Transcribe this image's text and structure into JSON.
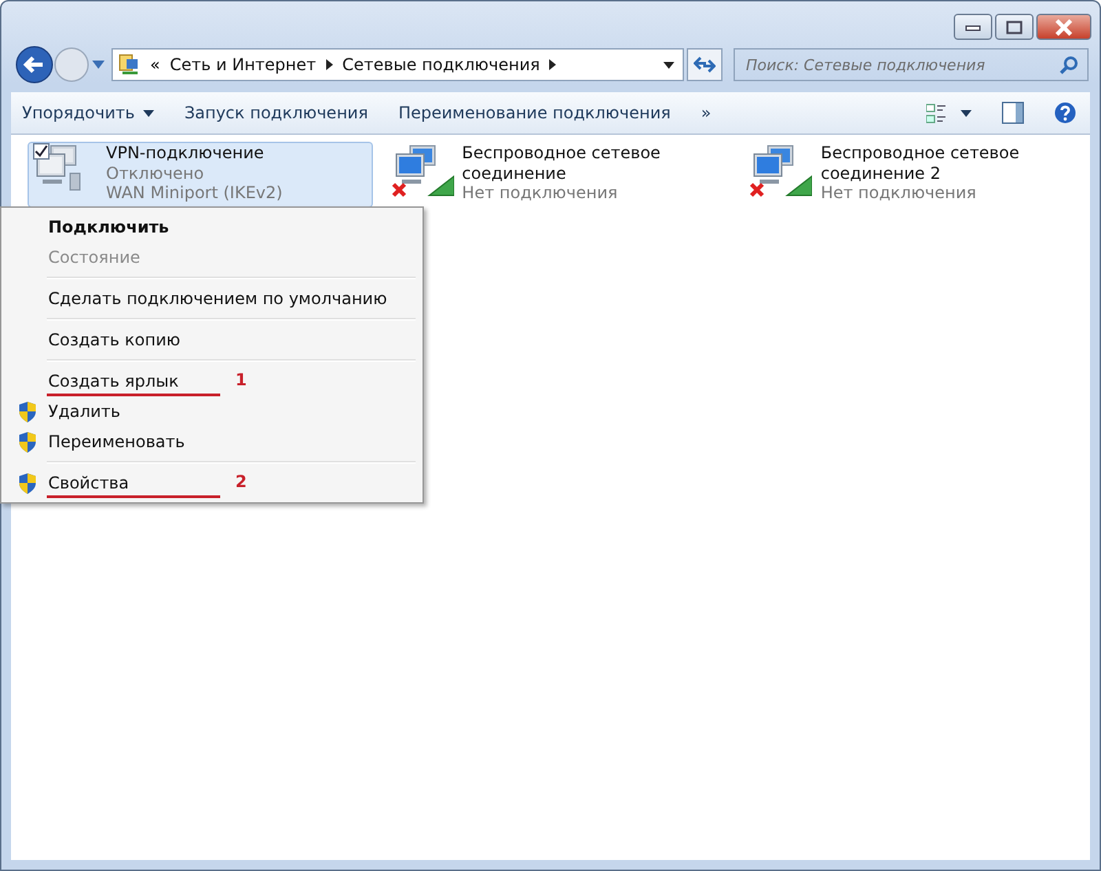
{
  "address_bar": {
    "overflow": "«",
    "crumbs": [
      "Сеть и Интернет",
      "Сетевые подключения"
    ]
  },
  "search": {
    "placeholder": "Поиск: Сетевые подключения"
  },
  "toolbar": {
    "items": [
      {
        "label": "Упорядочить",
        "dropdown": true
      },
      {
        "label": "Запуск подключения",
        "dropdown": false
      },
      {
        "label": "Переименование подключения",
        "dropdown": false
      }
    ],
    "more": "»"
  },
  "connections": [
    {
      "kind": "vpn",
      "name": "VPN-подключение",
      "status": "Отключено",
      "device": "WAN Miniport (IKEv2)",
      "selected": true,
      "checked": true
    },
    {
      "kind": "wireless",
      "name": "Беспроводное сетевое соединение",
      "status": "Нет подключения",
      "selected": false,
      "checked": false
    },
    {
      "kind": "wireless",
      "name": "Беспроводное сетевое соединение 2",
      "status": "Нет подключения",
      "selected": false,
      "checked": false
    }
  ],
  "context_menu": {
    "sections": [
      [
        {
          "label": "Подключить",
          "default": true,
          "disabled": false,
          "shield": false
        },
        {
          "label": "Состояние",
          "default": false,
          "disabled": true,
          "shield": false
        }
      ],
      [
        {
          "label": "Сделать подключением по умолчанию",
          "default": false,
          "disabled": false,
          "shield": false
        }
      ],
      [
        {
          "label": "Создать копию",
          "default": false,
          "disabled": false,
          "shield": false
        }
      ],
      [
        {
          "label": "Создать ярлык",
          "default": false,
          "disabled": false,
          "shield": false,
          "annotation": "1"
        },
        {
          "label": "Удалить",
          "default": false,
          "disabled": false,
          "shield": true
        },
        {
          "label": "Переименовать",
          "default": false,
          "disabled": false,
          "shield": true
        }
      ],
      [
        {
          "label": "Свойства",
          "default": false,
          "disabled": false,
          "shield": true,
          "annotation": "2"
        }
      ]
    ]
  }
}
